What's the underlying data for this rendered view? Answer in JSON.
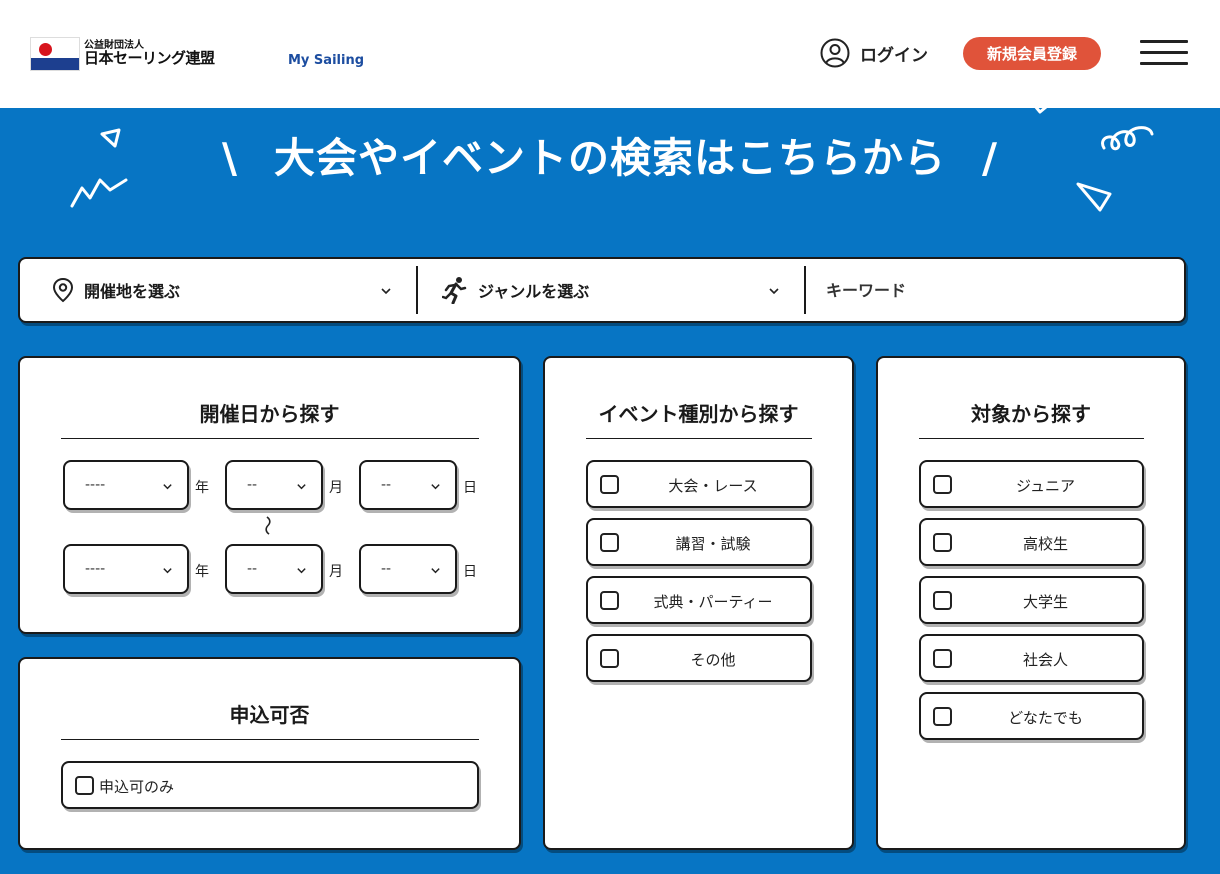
{
  "header": {
    "logo_sub": "公益財団法人",
    "logo_main": "日本セーリング連盟",
    "my_sailing": "My Sailing",
    "login_label": "ログイン",
    "signup_label": "新規会員登録"
  },
  "hero": {
    "title": "大会やイベントの検索はこちらから",
    "slash_left": "\\",
    "slash_right": "/"
  },
  "search": {
    "location_label": "開催地を選ぶ",
    "genre_label": "ジャンルを選ぶ",
    "keyword_placeholder": "キーワード"
  },
  "date_panel": {
    "title": "開催日から探す",
    "year_placeholder": "----",
    "month_placeholder": "--",
    "day_placeholder": "--",
    "year_unit": "年",
    "month_unit": "月",
    "day_unit": "日",
    "range_separator": "〜"
  },
  "apply_panel": {
    "title": "申込可否",
    "options": [
      {
        "label": "申込可のみ"
      }
    ]
  },
  "event_type_panel": {
    "title": "イベント種別から探す",
    "options": [
      {
        "label": "大会・レース"
      },
      {
        "label": "講習・試験"
      },
      {
        "label": "式典・パーティー"
      },
      {
        "label": "その他"
      }
    ]
  },
  "target_panel": {
    "title": "対象から探す",
    "options": [
      {
        "label": "ジュニア"
      },
      {
        "label": "高校生"
      },
      {
        "label": "大学生"
      },
      {
        "label": "社会人"
      },
      {
        "label": "どなたでも"
      }
    ]
  },
  "icons": {
    "user": "user-circle-icon",
    "menu": "hamburger-menu-icon",
    "location": "map-pin-icon",
    "genre": "running-person-icon",
    "chevron": "chevron-down-icon"
  },
  "colors": {
    "background": "#0775c4",
    "signup": "#e0533a",
    "brand_text": "#1c4da0"
  }
}
